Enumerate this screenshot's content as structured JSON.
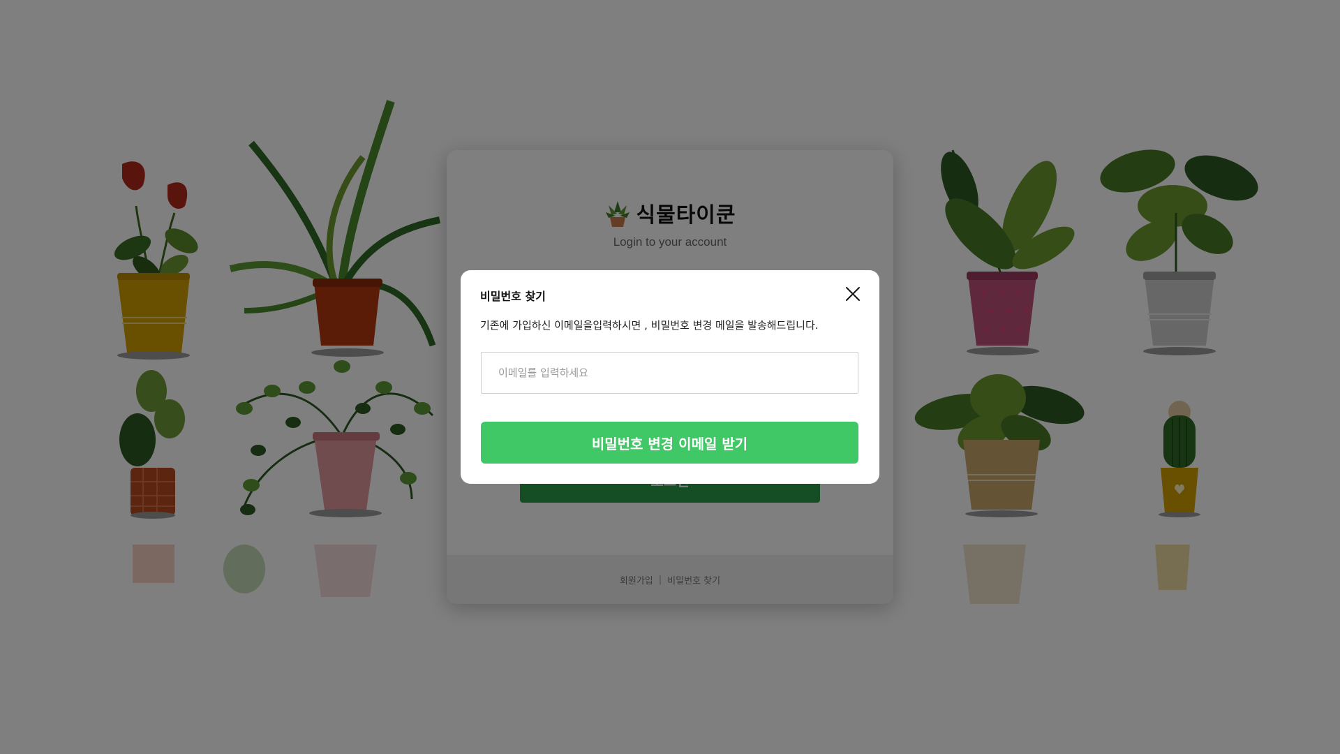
{
  "login": {
    "brand_name": "식물타이쿤",
    "subtitle": "Login to your account",
    "login_button_label": "로그인",
    "footer": {
      "signup_link": "회원가입",
      "separator": "|",
      "find_password_link": "비밀번호 찾기"
    }
  },
  "modal": {
    "title": "비밀번호 찾기",
    "description": "기존에 가입하신 이메일을입력하시면 , 비밀번호 변경 메일을 발송해드립니다.",
    "email_placeholder": "이메일를 입력하세요",
    "email_value": "",
    "submit_label": "비밀번호 변경 이메일 받기",
    "close_icon": "close-icon"
  },
  "colors": {
    "overlay": "rgba(0,0,0,0.5)",
    "primary_green": "#41c866",
    "dark_green": "#2a9d4a"
  }
}
